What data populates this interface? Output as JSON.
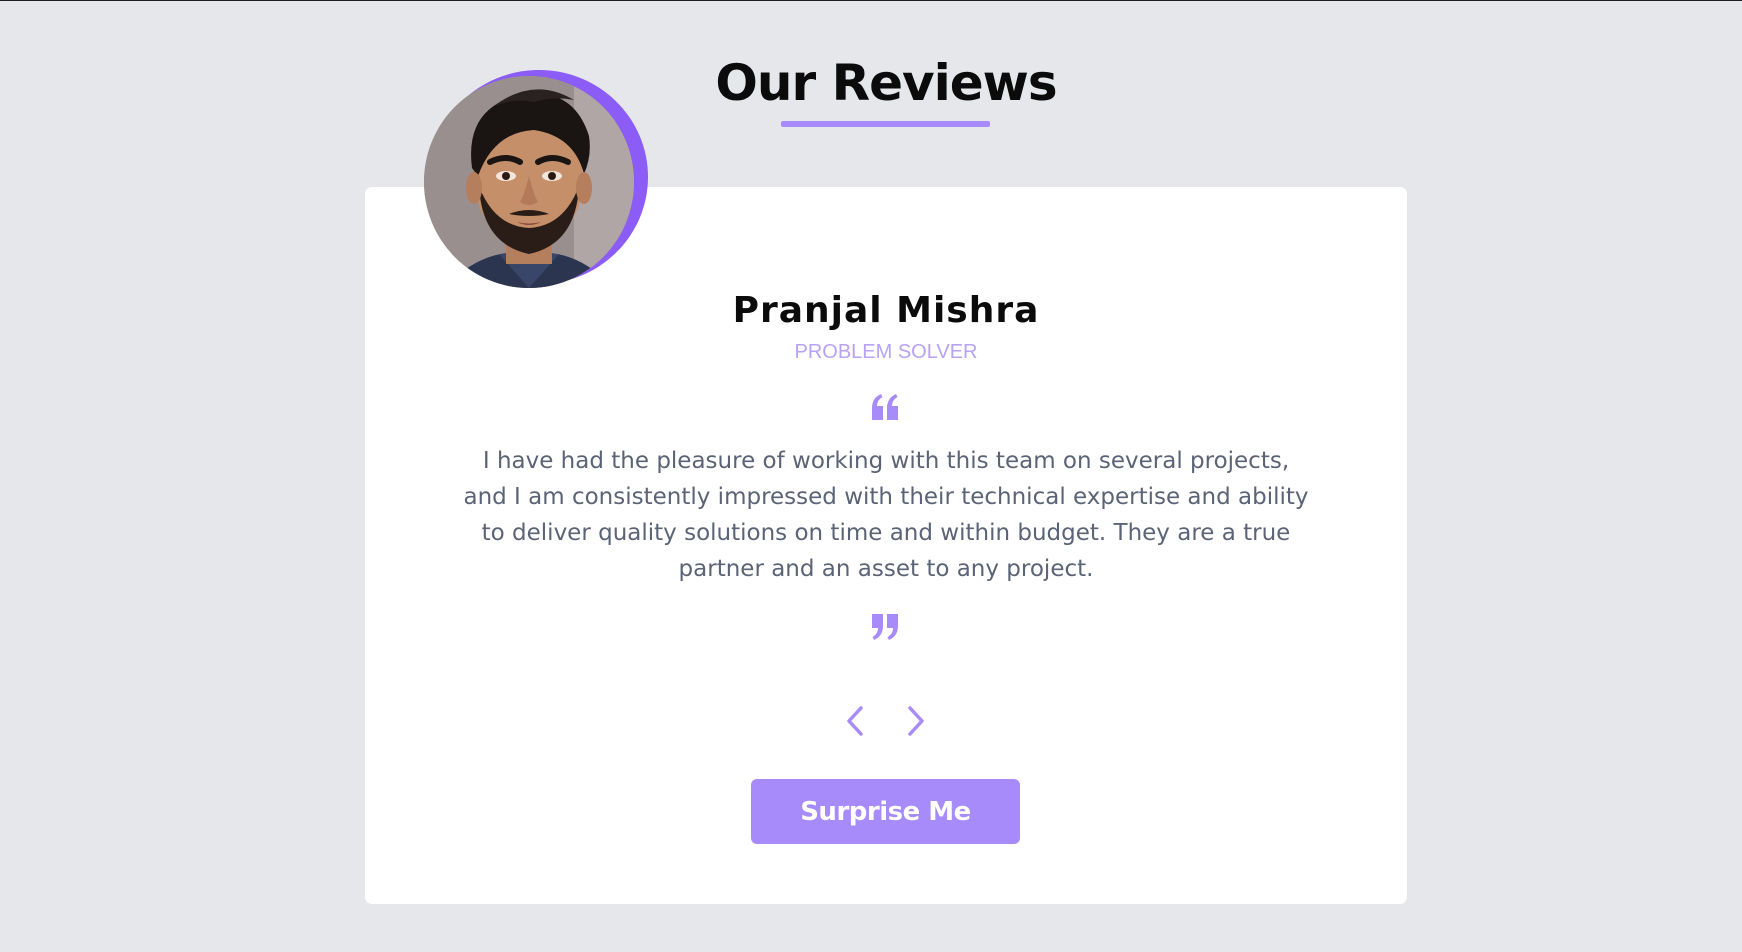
{
  "header": {
    "title": "Our Reviews"
  },
  "review": {
    "name": "Pranjal Mishra",
    "role": "Problem Solver",
    "text": "I have had the pleasure of working with this team on several projects, and I am consistently impressed with their technical expertise and ability to deliver quality solutions on time and within budget. They are a true partner and an asset to any project.",
    "avatar_icon": "portrait-photo",
    "quote_open_icon": "quote-left-icon",
    "quote_close_icon": "quote-right-icon"
  },
  "navigation": {
    "prev_icon": "chevron-left-icon",
    "next_icon": "chevron-right-icon"
  },
  "actions": {
    "surprise_label": "Surprise Me"
  },
  "colors": {
    "accent": "#a78bfa",
    "accent_dark": "#8b5cf6",
    "background": "#e5e7eb",
    "card": "#ffffff",
    "text_muted": "#5b6476"
  }
}
